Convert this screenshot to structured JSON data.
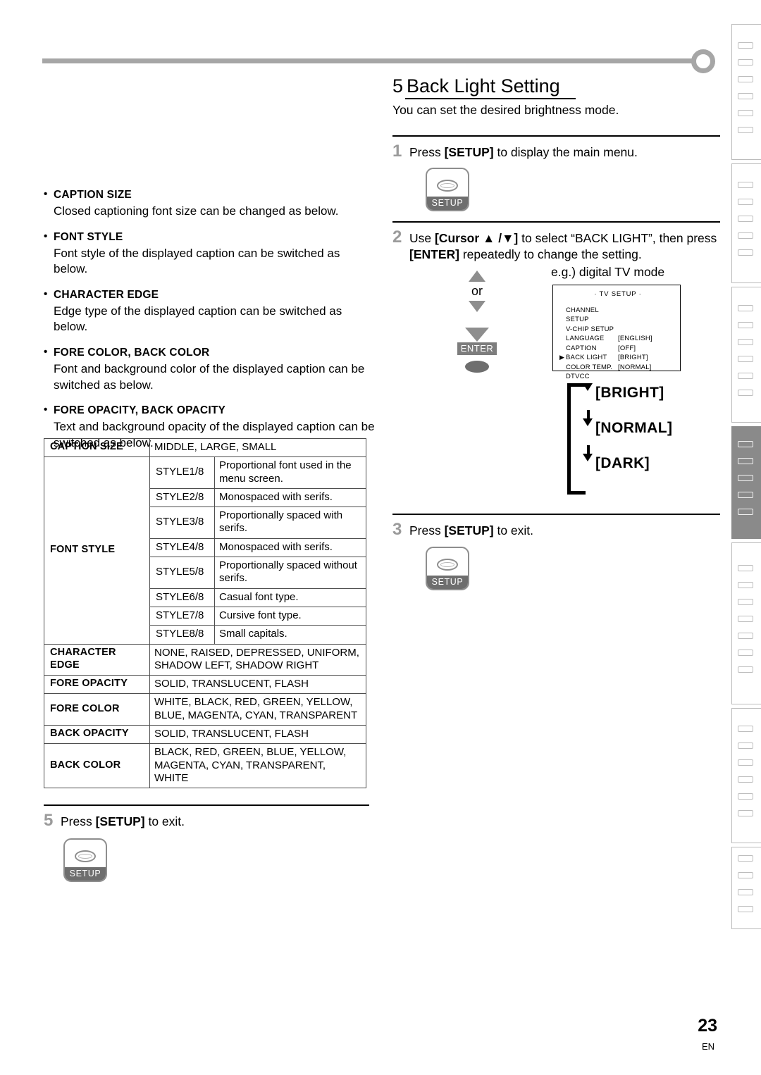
{
  "page": {
    "number": "23",
    "language_code": "EN"
  },
  "left_column": {
    "bullets": [
      {
        "title": "CAPTION SIZE",
        "body": "Closed captioning font size can be changed as below."
      },
      {
        "title": "FONT STYLE",
        "body": "Font style of the displayed caption can be switched as below."
      },
      {
        "title": "CHARACTER EDGE",
        "body": "Edge type of the displayed caption can be switched as below."
      },
      {
        "title": "FORE COLOR, BACK COLOR",
        "body": "Font and background color of the displayed caption can be switched as below."
      },
      {
        "title": "FORE OPACITY, BACK OPACITY",
        "body": "Text and background opacity of the displayed caption can be switched as below."
      }
    ],
    "table": {
      "caption_size": {
        "key": "CAPTION SIZE",
        "value": "MIDDLE, LARGE, SMALL"
      },
      "font_style": {
        "key": "FONT STYLE",
        "rows": [
          {
            "style": "STYLE1/8",
            "desc": "Proportional font used in the menu screen."
          },
          {
            "style": "STYLE2/8",
            "desc": "Monospaced with serifs."
          },
          {
            "style": "STYLE3/8",
            "desc": "Proportionally spaced with serifs."
          },
          {
            "style": "STYLE4/8",
            "desc": "Monospaced with serifs."
          },
          {
            "style": "STYLE5/8",
            "desc": "Proportionally spaced without serifs."
          },
          {
            "style": "STYLE6/8",
            "desc": "Casual font type."
          },
          {
            "style": "STYLE7/8",
            "desc": "Cursive font type."
          },
          {
            "style": "STYLE8/8",
            "desc": "Small capitals."
          }
        ]
      },
      "others": [
        {
          "key": "CHARACTER EDGE",
          "value": "NONE, RAISED, DEPRESSED, UNIFORM, SHADOW LEFT, SHADOW RIGHT"
        },
        {
          "key": "FORE OPACITY",
          "value": "SOLID, TRANSLUCENT, FLASH"
        },
        {
          "key": "FORE COLOR",
          "value": "WHITE, BLACK, RED, GREEN, YELLOW, BLUE, MAGENTA, CYAN, TRANSPARENT"
        },
        {
          "key": "BACK OPACITY",
          "value": "SOLID, TRANSLUCENT, FLASH"
        },
        {
          "key": "BACK COLOR",
          "value": "BLACK, RED, GREEN, BLUE, YELLOW, MAGENTA, CYAN, TRANSPARENT, WHITE"
        }
      ]
    },
    "step5": {
      "number": "5",
      "text_before": "Press ",
      "key": "[SETUP]",
      "text_after": " to exit.",
      "button_label": "SETUP"
    }
  },
  "right_column": {
    "heading": {
      "number": "5",
      "title": "Back Light Setting",
      "subtitle": "You can set the desired brightness mode."
    },
    "step1": {
      "number": "1",
      "text_before": "Press ",
      "key": "[SETUP]",
      "text_after": " to display the main menu.",
      "button_label": "SETUP"
    },
    "step2": {
      "number": "2",
      "line1_a": "Use ",
      "line1_key": "[Cursor ▲ /▼]",
      "line1_b": " to select “BACK LIGHT”, then press",
      "line2_key": "[ENTER]",
      "line2_b": " repeatedly to change the setting.",
      "or_label": "or",
      "enter_label": "ENTER",
      "eg_label": "e.g.) digital TV mode",
      "osd": {
        "title": "·  TV SETUP  ·",
        "rows": [
          {
            "name": "CHANNEL SETUP",
            "value": "",
            "selected": false
          },
          {
            "name": "V-CHIP  SETUP",
            "value": "",
            "selected": false
          },
          {
            "name": "LANGUAGE",
            "value": "[ENGLISH]",
            "selected": false
          },
          {
            "name": "CAPTION",
            "value": "[OFF]",
            "selected": false
          },
          {
            "name": "BACK  LIGHT",
            "value": "[BRIGHT]",
            "selected": true
          },
          {
            "name": "COLOR  TEMP.",
            "value": "[NORMAL]",
            "selected": false
          },
          {
            "name": "DTVCC",
            "value": "",
            "selected": false
          }
        ],
        "selection_marker": "▶"
      },
      "cycle": {
        "options": [
          "[BRIGHT]",
          "[NORMAL]",
          "[DARK]"
        ]
      }
    },
    "step3": {
      "number": "3",
      "text_before": "Press ",
      "key": "[SETUP]",
      "text_after": " to exit.",
      "button_label": "SETUP"
    }
  },
  "decor": {
    "rule_color": "#a6a6a6",
    "tab_active_color": "#8a8a8a",
    "tab_border_color": "#bbbbbb"
  }
}
